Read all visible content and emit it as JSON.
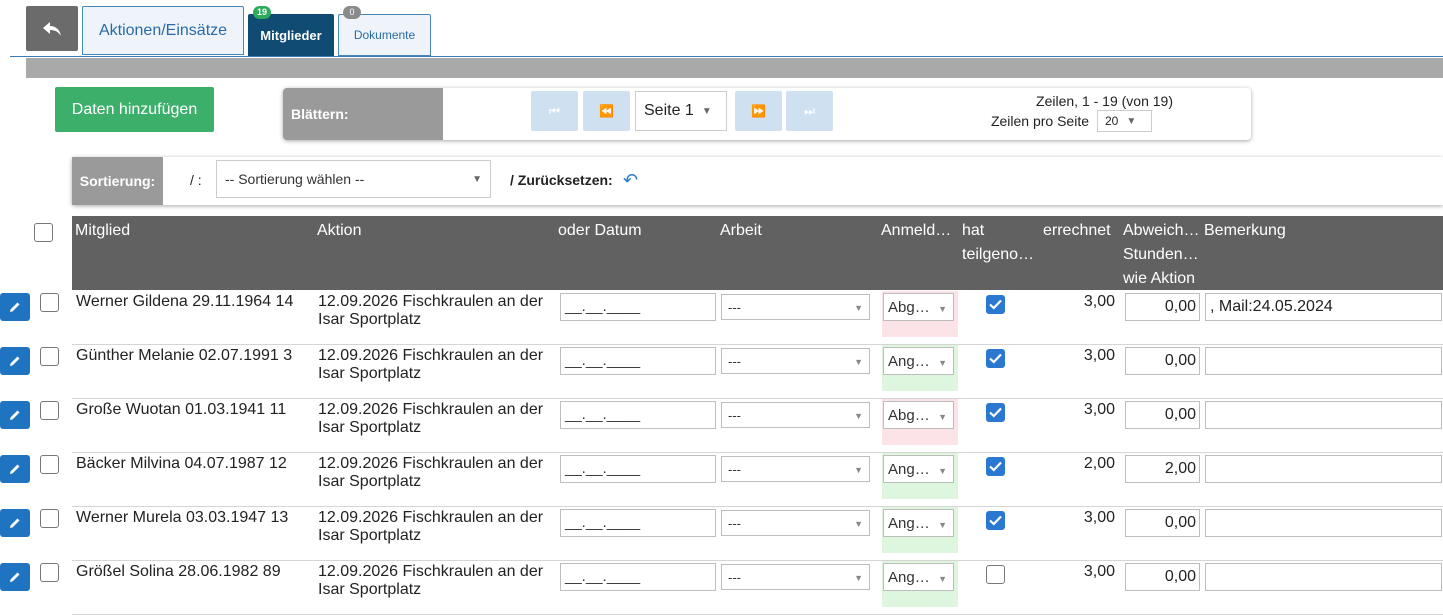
{
  "tabs": {
    "back_icon": "reply-icon",
    "actions_label": "Aktionen/Einsätze",
    "members_label": "Mitglieder",
    "members_badge": "19",
    "documents_label": "Dokumente",
    "documents_badge": "0"
  },
  "add_button_label": "Daten hinzufügen",
  "pager": {
    "label": "Blättern:",
    "page_select": "Seite 1",
    "rows_info": "Zeilen, 1 - 19 (von 19)",
    "rows_per_page_label": "Zeilen pro Seite",
    "rows_per_page_value": "20"
  },
  "sort": {
    "label": "Sortierung:",
    "separator": "/ :",
    "placeholder": "-- Sortierung wählen --",
    "reset_label": "/ Zurücksetzen:"
  },
  "columns": {
    "member": "Mitglied",
    "action": "Aktion",
    "date": "oder Datum",
    "work": "Arbeit",
    "registration": "Anmeld…",
    "took_part_1": "hat",
    "took_part_2": "teilgeno…",
    "calculated": "errechnet",
    "deviation_1": "Abweich…",
    "deviation_2": "Stunden…",
    "deviation_3": "wie Aktion",
    "note": "Bemerkung"
  },
  "rows": [
    {
      "member": "Werner Gildena 29.11.1964 14",
      "action": "12.09.2026 Fischkraulen an der Isar Sportplatz",
      "date": "__.__.____",
      "work": "---",
      "registration": "Abg…",
      "reg_status": "neg",
      "took_part": true,
      "calculated": "3,00",
      "deviation": "0,00",
      "note": ", Mail:24.05.2024"
    },
    {
      "member": "Günther Melanie 02.07.1991 3",
      "action": "12.09.2026 Fischkraulen an der Isar Sportplatz",
      "date": "__.__.____",
      "work": "---",
      "registration": "Ang…",
      "reg_status": "pos",
      "took_part": true,
      "calculated": "3,00",
      "deviation": "0,00",
      "note": ""
    },
    {
      "member": "Große Wuotan 01.03.1941 11",
      "action": "12.09.2026 Fischkraulen an der Isar Sportplatz",
      "date": "__.__.____",
      "work": "---",
      "registration": "Abg…",
      "reg_status": "neg",
      "took_part": true,
      "calculated": "3,00",
      "deviation": "0,00",
      "note": ""
    },
    {
      "member": "Bäcker Milvina 04.07.1987 12",
      "action": "12.09.2026 Fischkraulen an der Isar Sportplatz",
      "date": "__.__.____",
      "work": "---",
      "registration": "Ang…",
      "reg_status": "pos",
      "took_part": true,
      "calculated": "2,00",
      "deviation": "2,00",
      "note": ""
    },
    {
      "member": "Werner Murela 03.03.1947 13",
      "action": "12.09.2026 Fischkraulen an der Isar Sportplatz",
      "date": "__.__.____",
      "work": "---",
      "registration": "Ang…",
      "reg_status": "pos",
      "took_part": true,
      "calculated": "3,00",
      "deviation": "0,00",
      "note": ""
    },
    {
      "member": "Größel Solina 28.06.1982 89",
      "action": "12.09.2026 Fischkraulen an der Isar Sportplatz",
      "date": "__.__.____",
      "work": "---",
      "registration": "Ang…",
      "reg_status": "pos",
      "took_part": false,
      "calculated": "3,00",
      "deviation": "0,00",
      "note": ""
    }
  ]
}
